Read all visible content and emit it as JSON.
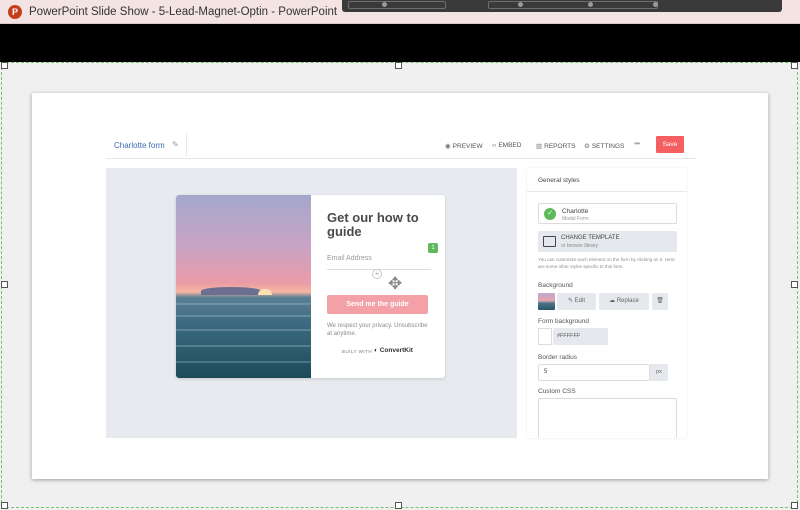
{
  "window": {
    "title": "PowerPoint Slide Show  -  5-Lead-Magnet-Optin  -  PowerPoint",
    "app_icon": "P"
  },
  "app": {
    "form_name": "Charlotte form",
    "nav": {
      "preview": "PREVIEW",
      "embed": "EMBED",
      "reports": "REPORTS",
      "settings": "SETTINGS"
    },
    "more": "•••",
    "save": "Save",
    "accent_color": "#f45f61"
  },
  "form": {
    "title": "Get our how to guide",
    "email_placeholder": "Email Address",
    "button": "Send me the guide",
    "privacy": "We respect your privacy. Unsubscribe at anytime.",
    "built_with": "BUILT WITH",
    "brand": "ConvertKit",
    "badge": "1"
  },
  "panel": {
    "header": "General styles",
    "template_name": "Charlotte",
    "template_type": "Modal Form",
    "change_template": "CHANGE TEMPLATE",
    "browse": "or browse library",
    "help_text": "You can customize each element on the form by clicking on it. Here are some other styles specific to this form.",
    "background_label": "Background",
    "edit": "Edit",
    "replace": "Replace",
    "form_background_label": "Form background",
    "form_background_value": "#FFFFFF",
    "border_radius_label": "Border radius",
    "border_radius_value": "5",
    "border_radius_unit": "px",
    "custom_css_label": "Custom CSS"
  }
}
